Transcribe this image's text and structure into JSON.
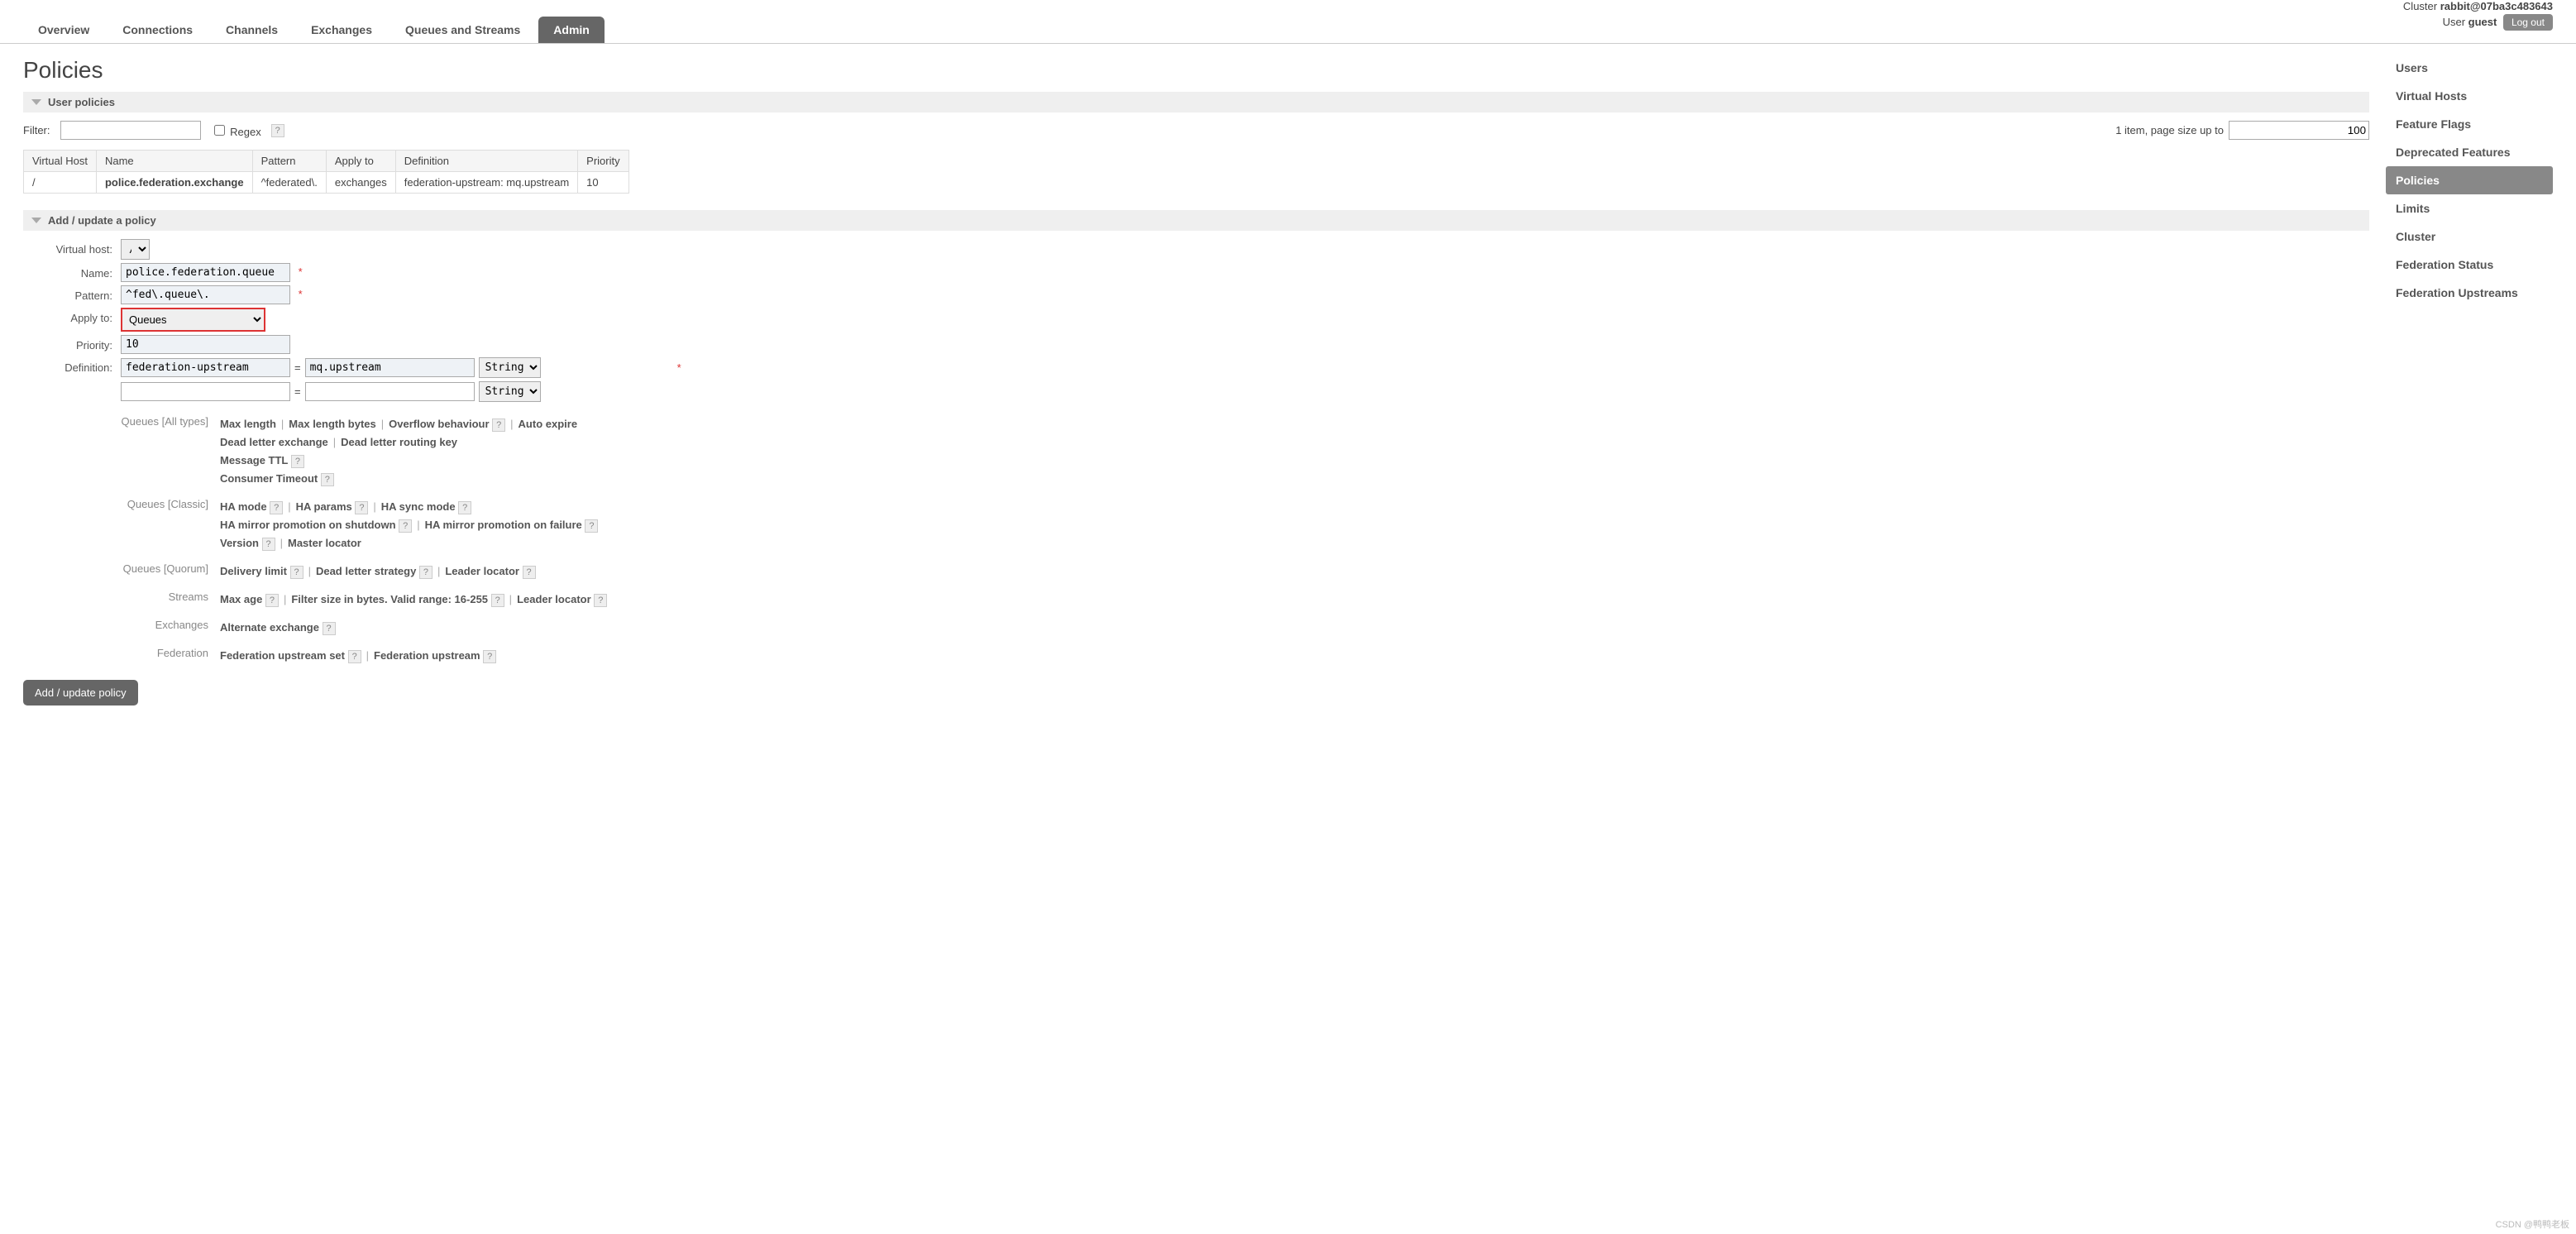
{
  "header": {
    "cluster_label": "Cluster",
    "cluster_name": "rabbit@07ba3c483643",
    "user_label": "User",
    "user_name": "guest",
    "logout": "Log out"
  },
  "tabs": [
    {
      "label": "Overview"
    },
    {
      "label": "Connections"
    },
    {
      "label": "Channels"
    },
    {
      "label": "Exchanges"
    },
    {
      "label": "Queues and Streams"
    },
    {
      "label": "Admin",
      "active": true
    }
  ],
  "page_title": "Policies",
  "user_policies": {
    "header": "User policies",
    "filter_label": "Filter:",
    "filter_value": "",
    "regex_label": "Regex",
    "page_info": "1 item, page size up to",
    "page_size": "100",
    "columns": [
      "Virtual Host",
      "Name",
      "Pattern",
      "Apply to",
      "Definition",
      "Priority"
    ],
    "rows": [
      {
        "vhost": "/",
        "name": "police.federation.exchange",
        "pattern": "^federated\\.",
        "apply_to": "exchanges",
        "definition_key": "federation-upstream:",
        "definition_val": "mq.upstream",
        "priority": "10"
      }
    ]
  },
  "add_policy": {
    "header": "Add / update a policy",
    "labels": {
      "vhost": "Virtual host:",
      "name": "Name:",
      "pattern": "Pattern:",
      "apply_to": "Apply to:",
      "priority": "Priority:",
      "definition": "Definition:"
    },
    "vhost_value": "/",
    "name_value": "police.federation.queue",
    "pattern_value": "^fed\\.queue\\.",
    "apply_to_value": "Queues",
    "priority_value": "10",
    "def_key": "federation-upstream",
    "def_val": "mq.upstream",
    "type_options": [
      "String"
    ],
    "equals": "=",
    "button": "Add / update policy"
  },
  "helpers": [
    {
      "label": "Queues [All types]",
      "lines": [
        [
          "Max length",
          "Max length bytes",
          "Overflow behaviour ?",
          "Auto expire"
        ],
        [
          "Dead letter exchange",
          "Dead letter routing key"
        ],
        [
          "Message TTL ?"
        ],
        [
          "Consumer Timeout ?"
        ]
      ]
    },
    {
      "label": "Queues [Classic]",
      "lines": [
        [
          "HA mode ?",
          "HA params ?",
          "HA sync mode ?"
        ],
        [
          "HA mirror promotion on shutdown ?",
          "HA mirror promotion on failure ?"
        ],
        [
          "Version ?",
          "Master locator"
        ]
      ]
    },
    {
      "label": "Queues [Quorum]",
      "lines": [
        [
          "Delivery limit ?",
          "Dead letter strategy ?",
          "Leader locator ?"
        ]
      ]
    },
    {
      "label": "Streams",
      "lines": [
        [
          "Max age ?",
          "Filter size in bytes. Valid range: 16-255 ?",
          "Leader locator ?"
        ]
      ]
    },
    {
      "label": "Exchanges",
      "lines": [
        [
          "Alternate exchange ?"
        ]
      ]
    },
    {
      "label": "Federation",
      "lines": [
        [
          "Federation upstream set ?",
          "Federation upstream ?"
        ]
      ]
    }
  ],
  "sidebar": [
    {
      "label": "Users"
    },
    {
      "label": "Virtual Hosts"
    },
    {
      "label": "Feature Flags"
    },
    {
      "label": "Deprecated Features"
    },
    {
      "label": "Policies",
      "active": true
    },
    {
      "label": "Limits"
    },
    {
      "label": "Cluster"
    },
    {
      "label": "Federation Status"
    },
    {
      "label": "Federation Upstreams"
    }
  ],
  "watermark": "CSDN @鸭鸭老板"
}
